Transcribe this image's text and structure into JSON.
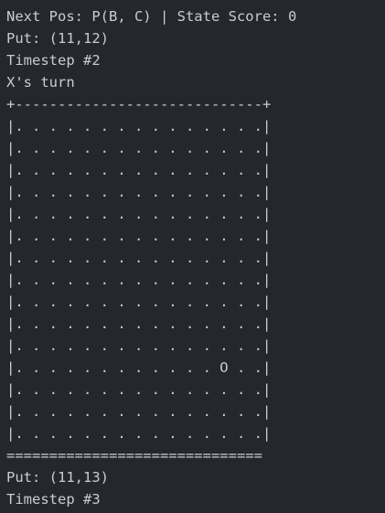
{
  "header": {
    "next_pos": "Next Pos: P(B, C) | State Score: 0",
    "put": "Put: (11,12)",
    "timestep": "Timestep #2",
    "turn": "X's turn"
  },
  "board": {
    "top_border": "+-----------------------------+",
    "rows": [
      "|. . . . . . . . . . . . . . .|",
      "|. . . . . . . . . . . . . . .|",
      "|. . . . . . . . . . . . . . .|",
      "|. . . . . . . . . . . . . . .|",
      "|. . . . . . . . . . . . . . .|",
      "|. . . . . . . . . . . . . . .|",
      "|. . . . . . . . . . . . . . .|",
      "|. . . . . . . . . . . . . . .|",
      "|. . . . . . . . . . . . . . .|",
      "|. . . . . . . . . . . . . . .|",
      "|. . . . . . . . . . . . . . .|",
      "|. . . . . . . . . . . . O . .|",
      "|. . . . . . . . . . . . . . .|",
      "|. . . . . . . . . . . . . . .|",
      "|. . . . . . . . . . . . . . .|"
    ],
    "bottom_border": "=============================="
  },
  "footer": {
    "put": "Put: (11,13)",
    "timestep": "Timestep #3"
  }
}
